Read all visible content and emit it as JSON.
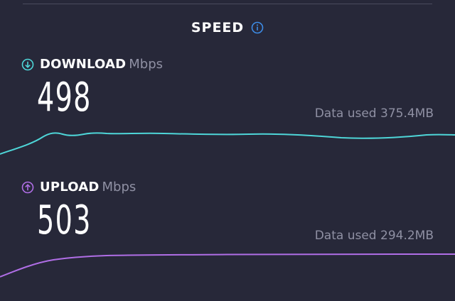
{
  "header": {
    "title": "SPEED",
    "info_icon": "info-circle-icon"
  },
  "colors": {
    "background": "#272839",
    "download_accent": "#4ed6d8",
    "upload_accent": "#b06ee6",
    "muted_text": "#8f90a3"
  },
  "download": {
    "label": "DOWNLOAD",
    "unit": "Mbps",
    "value": "498",
    "data_used": "Data used 375.4MB",
    "icon": "arrow-down-circle-icon"
  },
  "upload": {
    "label": "UPLOAD",
    "unit": "Mbps",
    "value": "503",
    "data_used": "Data used 294.2MB",
    "icon": "arrow-up-circle-icon"
  }
}
